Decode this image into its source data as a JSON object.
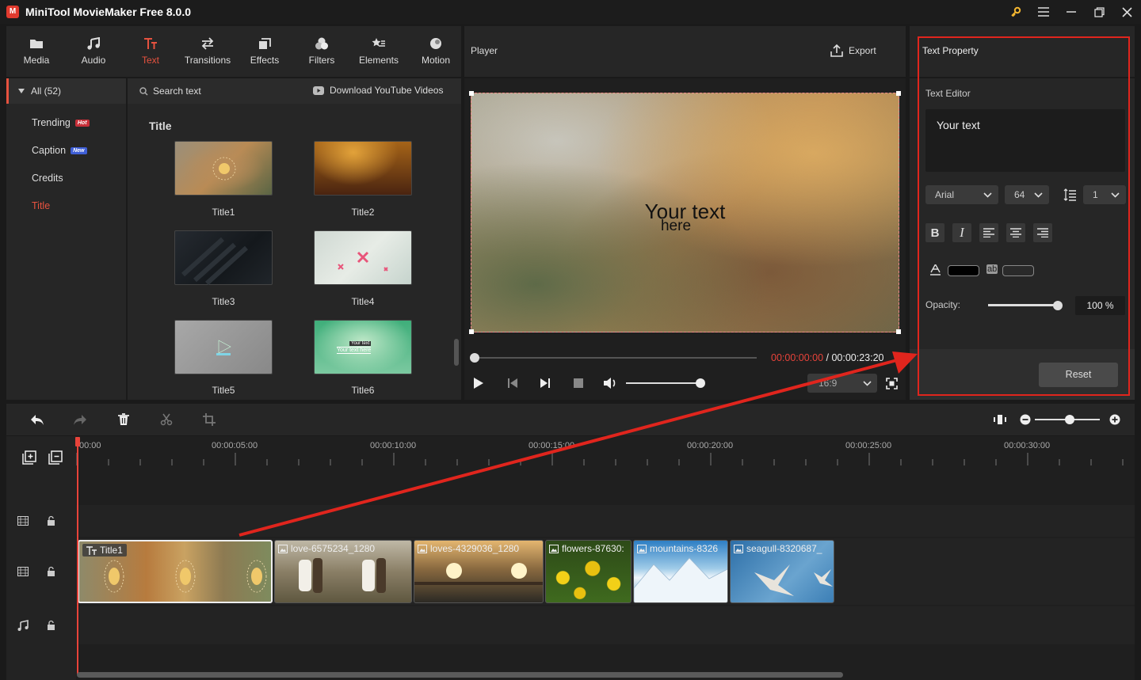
{
  "app": {
    "title": "MiniTool MovieMaker Free 8.0.0"
  },
  "toolbar": {
    "tools": [
      {
        "label": "Media"
      },
      {
        "label": "Audio"
      },
      {
        "label": "Text"
      },
      {
        "label": "Transitions"
      },
      {
        "label": "Effects"
      },
      {
        "label": "Filters"
      },
      {
        "label": "Elements"
      },
      {
        "label": "Motion"
      }
    ]
  },
  "categories": {
    "all": "All (52)",
    "items": [
      {
        "label": "Trending",
        "badge": "Hot"
      },
      {
        "label": "Caption",
        "badge": "New"
      },
      {
        "label": "Credits"
      },
      {
        "label": "Title"
      }
    ]
  },
  "library": {
    "search_placeholder": "Search text",
    "download_label": "Download YouTube Videos",
    "section_title": "Title",
    "thumbs": [
      {
        "label": "Title1"
      },
      {
        "label": "Title2"
      },
      {
        "label": "Title3"
      },
      {
        "label": "Title4"
      },
      {
        "label": "Title5"
      },
      {
        "label": "Title6"
      }
    ],
    "title6_preview_top": "Your text",
    "title6_preview_bottom": "Your text here"
  },
  "player": {
    "label": "Player",
    "export_label": "Export",
    "overlay_line1": "Your text",
    "overlay_line2": "here",
    "time_current": "00:00:00:00",
    "time_sep": " / ",
    "time_total": "00:00:23:20",
    "aspect": "16:9"
  },
  "property": {
    "title": "Text Property",
    "editor_label": "Text Editor",
    "text_value": "Your text",
    "font": "Arial",
    "size": "64",
    "line_spacing": "1",
    "bold": "B",
    "italic": "I",
    "bg_label": "ab",
    "opacity_label": "Opacity:",
    "opacity_value": "100 %",
    "opacity": 1.0,
    "reset_label": "Reset"
  },
  "timeline": {
    "ruler": [
      "00:00",
      "00:00:05:00",
      "00:00:10:00",
      "00:00:15:00",
      "00:00:20:00",
      "00:00:25:00",
      "00:00:30:00"
    ],
    "clips": [
      {
        "label": "Title1"
      },
      {
        "label": "love-6575234_1280"
      },
      {
        "label": "loves-4329036_1280"
      },
      {
        "label": "flowers-87630:"
      },
      {
        "label": "mountains-8326"
      },
      {
        "label": "seagull-8320687_"
      }
    ]
  },
  "colors": {
    "accent": "#e6523f",
    "annotation": "#e0251d"
  }
}
